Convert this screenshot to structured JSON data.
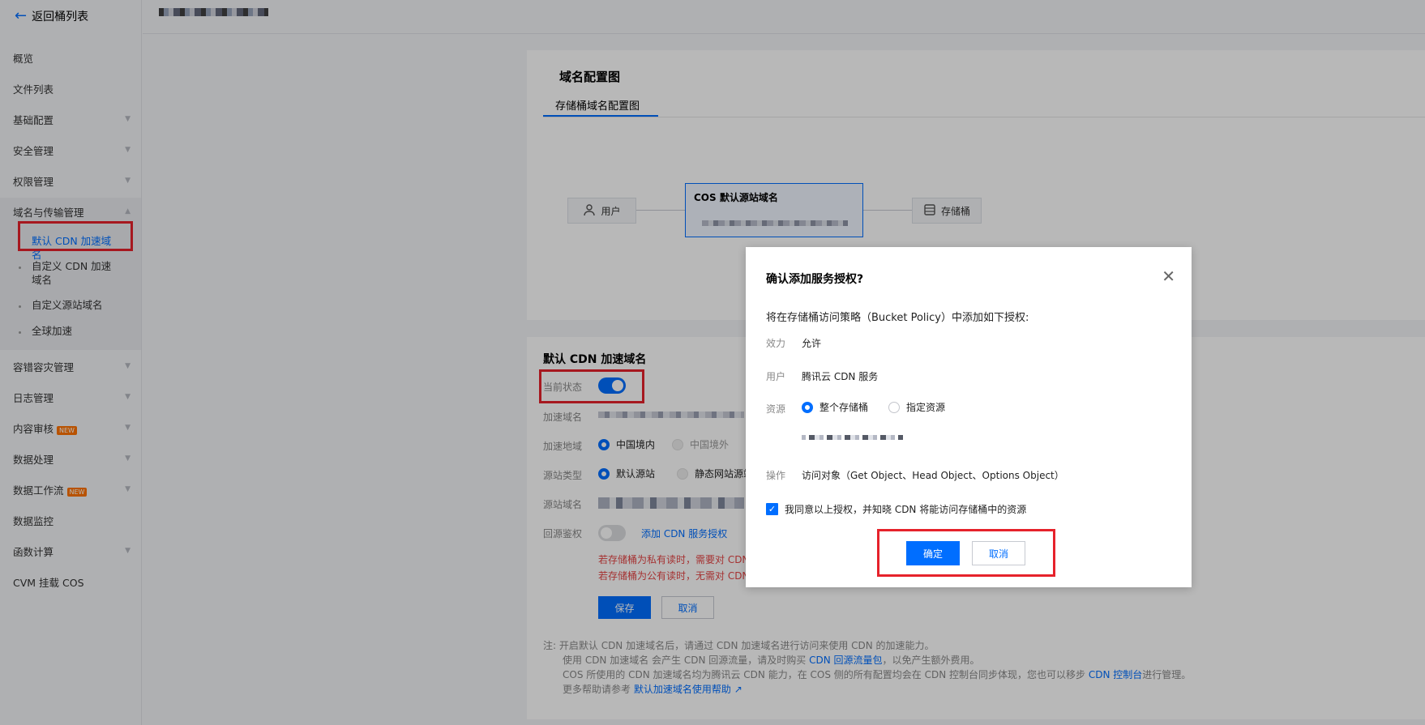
{
  "sidebar": {
    "back": "返回桶列表",
    "items": [
      "概览",
      "文件列表",
      "基础配置",
      "安全管理",
      "权限管理",
      "域名与传输管理"
    ],
    "sub_items": [
      "默认 CDN 加速域名",
      "自定义 CDN 加速域名",
      "自定义源站域名",
      "全球加速"
    ],
    "items2": [
      "容错容灾管理",
      "日志管理",
      "内容审核",
      "数据处理",
      "数据工作流",
      "数据监控",
      "函数计算",
      "CVM 挂载 COS"
    ],
    "badge_new": "NEW"
  },
  "diagram": {
    "title": "域名配置图",
    "tab": "存储桶域名配置图",
    "user": "用户",
    "main": "COS 默认源站域名",
    "bucket": "存储桶"
  },
  "cdn": {
    "title": "默认 CDN 加速域名",
    "status_label": "当前状态",
    "domain_label": "加速域名",
    "region_label": "加速地域",
    "region_in": "中国境内",
    "region_out": "中国境外",
    "type_label": "源站类型",
    "type_default": "默认源站",
    "type_static": "静态网站源站",
    "origin_label": "源站域名",
    "auth_label": "回源鉴权",
    "auth_link": "添加 CDN 服务授权",
    "warn1": "若存储桶为私有读时，需要对 CDN",
    "warn2": "若存储桶为公有读时，无需对 CDN",
    "save": "保存",
    "cancel": "取消",
    "note_prefix": "注:",
    "note1": "开启默认 CDN 加速域名后，请通过 CDN 加速域名进行访问来使用 CDN 的加速能力。",
    "note2a": "使用 CDN 加速域名 会产生 CDN 回源流量，请及时购买",
    "note2_link": "CDN 回源流量包",
    "note2b": "，以免产生额外费用。",
    "note3a": "COS 所使用的 CDN 加速域名均为腾讯云 CDN 能力，在 COS 侧的所有配置均会在 CDN 控制台同步体现，您也可以移步",
    "note3_link": "CDN 控制台",
    "note3b": "进行管理。",
    "note4a": "更多帮助请参考",
    "note4_link": "默认加速域名使用帮助"
  },
  "modal": {
    "title": "确认添加服务授权?",
    "desc": "将在存储桶访问策略（Bucket Policy）中添加如下授权:",
    "effect_label": "效力",
    "effect_value": "允许",
    "user_label": "用户",
    "user_value": "腾讯云 CDN 服务",
    "resource_label": "资源",
    "resource_all": "整个存储桶",
    "resource_specific": "指定资源",
    "action_label": "操作",
    "action_value": "访问对象（Get Object、Head Object、Options Object）",
    "agree": "我同意以上授权，并知晓 CDN 将能访问存储桶中的资源",
    "ok": "确定",
    "cancel": "取消"
  }
}
